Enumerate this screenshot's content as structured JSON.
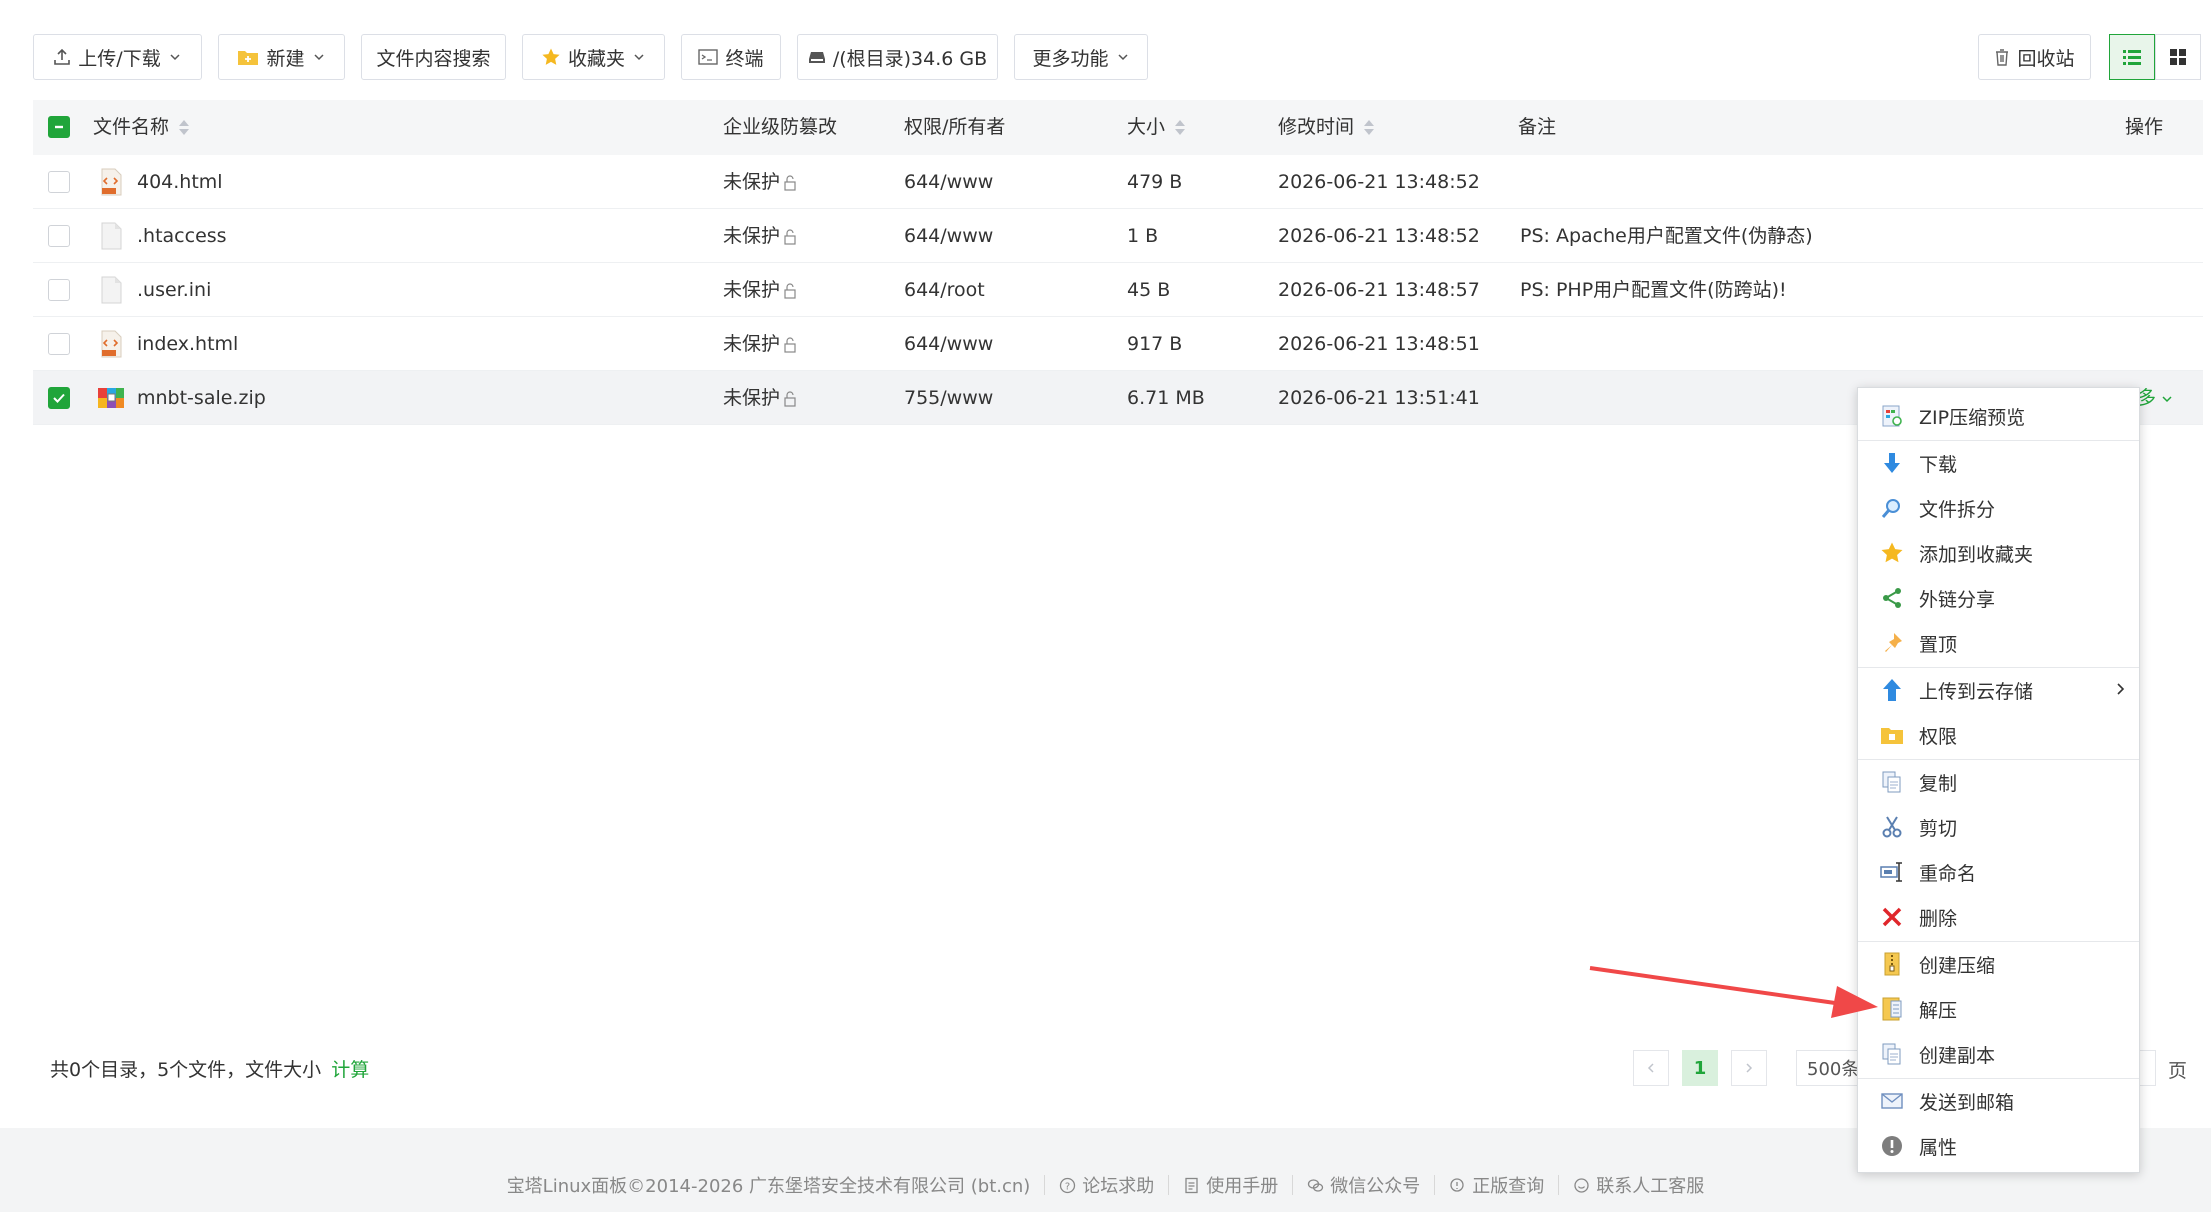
{
  "toolbar": {
    "upload_download": "上传/下载",
    "new": "新建",
    "content_search": "文件内容搜索",
    "favorites": "收藏夹",
    "terminal": "终端",
    "disk": "/(根目录)34.6 GB",
    "more_features": "更多功能",
    "recycle_bin": "回收站"
  },
  "table": {
    "headers": {
      "name": "文件名称",
      "tamper": "企业级防篡改",
      "perm_owner": "权限/所有者",
      "size": "大小",
      "mtime": "修改时间",
      "remark": "备注",
      "action": "操作"
    },
    "rows": [
      {
        "name": "404.html",
        "tamper": "未保护",
        "perm": "644/www",
        "size": "479 B",
        "mtime": "2026-06-21 13:48:52",
        "remark": "",
        "icon": "html-file-icon",
        "checked": false
      },
      {
        "name": ".htaccess",
        "tamper": "未保护",
        "perm": "644/www",
        "size": "1 B",
        "mtime": "2026-06-21 13:48:52",
        "remark": "PS: Apache用户配置文件(伪静态)",
        "icon": "text-file-icon",
        "checked": false
      },
      {
        "name": ".user.ini",
        "tamper": "未保护",
        "perm": "644/root",
        "size": "45 B",
        "mtime": "2026-06-21 13:48:57",
        "remark": "PS: PHP用户配置文件(防跨站)!",
        "icon": "text-file-icon",
        "checked": false
      },
      {
        "name": "index.html",
        "tamper": "未保护",
        "perm": "644/www",
        "size": "917 B",
        "mtime": "2026-06-21 13:48:51",
        "remark": "",
        "icon": "html-file-icon",
        "checked": false
      },
      {
        "name": "mnbt-sale.zip",
        "tamper": "未保护",
        "perm": "755/www",
        "size": "6.71 MB",
        "mtime": "2026-06-21 13:51:41",
        "remark": "",
        "icon": "zip-file-icon",
        "checked": true
      }
    ],
    "row_more_fragment": "多"
  },
  "footer_bar": {
    "summary": "共0个目录，5个文件，文件大小",
    "calc": "计算",
    "current_page": "1",
    "per_page": "500条",
    "page_suffix": "页"
  },
  "context_menu": {
    "items": [
      {
        "label": "ZIP压缩预览",
        "icon": "zip-preview-icon"
      },
      {
        "label": "下载",
        "icon": "download-arrow-icon"
      },
      {
        "label": "文件拆分",
        "icon": "split-magnifier-icon"
      },
      {
        "label": "添加到收藏夹",
        "icon": "star-icon"
      },
      {
        "label": "外链分享",
        "icon": "share-icon"
      },
      {
        "label": "置顶",
        "icon": "pin-icon"
      },
      {
        "label": "上传到云存储",
        "icon": "cloud-upload-icon"
      },
      {
        "label": "权限",
        "icon": "permission-folder-icon"
      },
      {
        "label": "复制",
        "icon": "copy-icon"
      },
      {
        "label": "剪切",
        "icon": "scissors-icon"
      },
      {
        "label": "重命名",
        "icon": "rename-icon"
      },
      {
        "label": "删除",
        "icon": "delete-x-icon"
      },
      {
        "label": "创建压缩",
        "icon": "compress-icon"
      },
      {
        "label": "解压",
        "icon": "extract-icon"
      },
      {
        "label": "创建副本",
        "icon": "duplicate-icon"
      },
      {
        "label": "发送到邮箱",
        "icon": "mail-icon"
      },
      {
        "label": "属性",
        "icon": "info-icon"
      }
    ]
  },
  "site_footer": {
    "copyright": "宝塔Linux面板©2014-2026 广东堡塔安全技术有限公司 (bt.cn)",
    "forum": "论坛求助",
    "manual": "使用手册",
    "wechat": "微信公众号",
    "genuine": "正版查询",
    "support": "联系人工客服"
  },
  "colors": {
    "accent": "#20a53a",
    "annotation_arrow": "#f04848"
  }
}
